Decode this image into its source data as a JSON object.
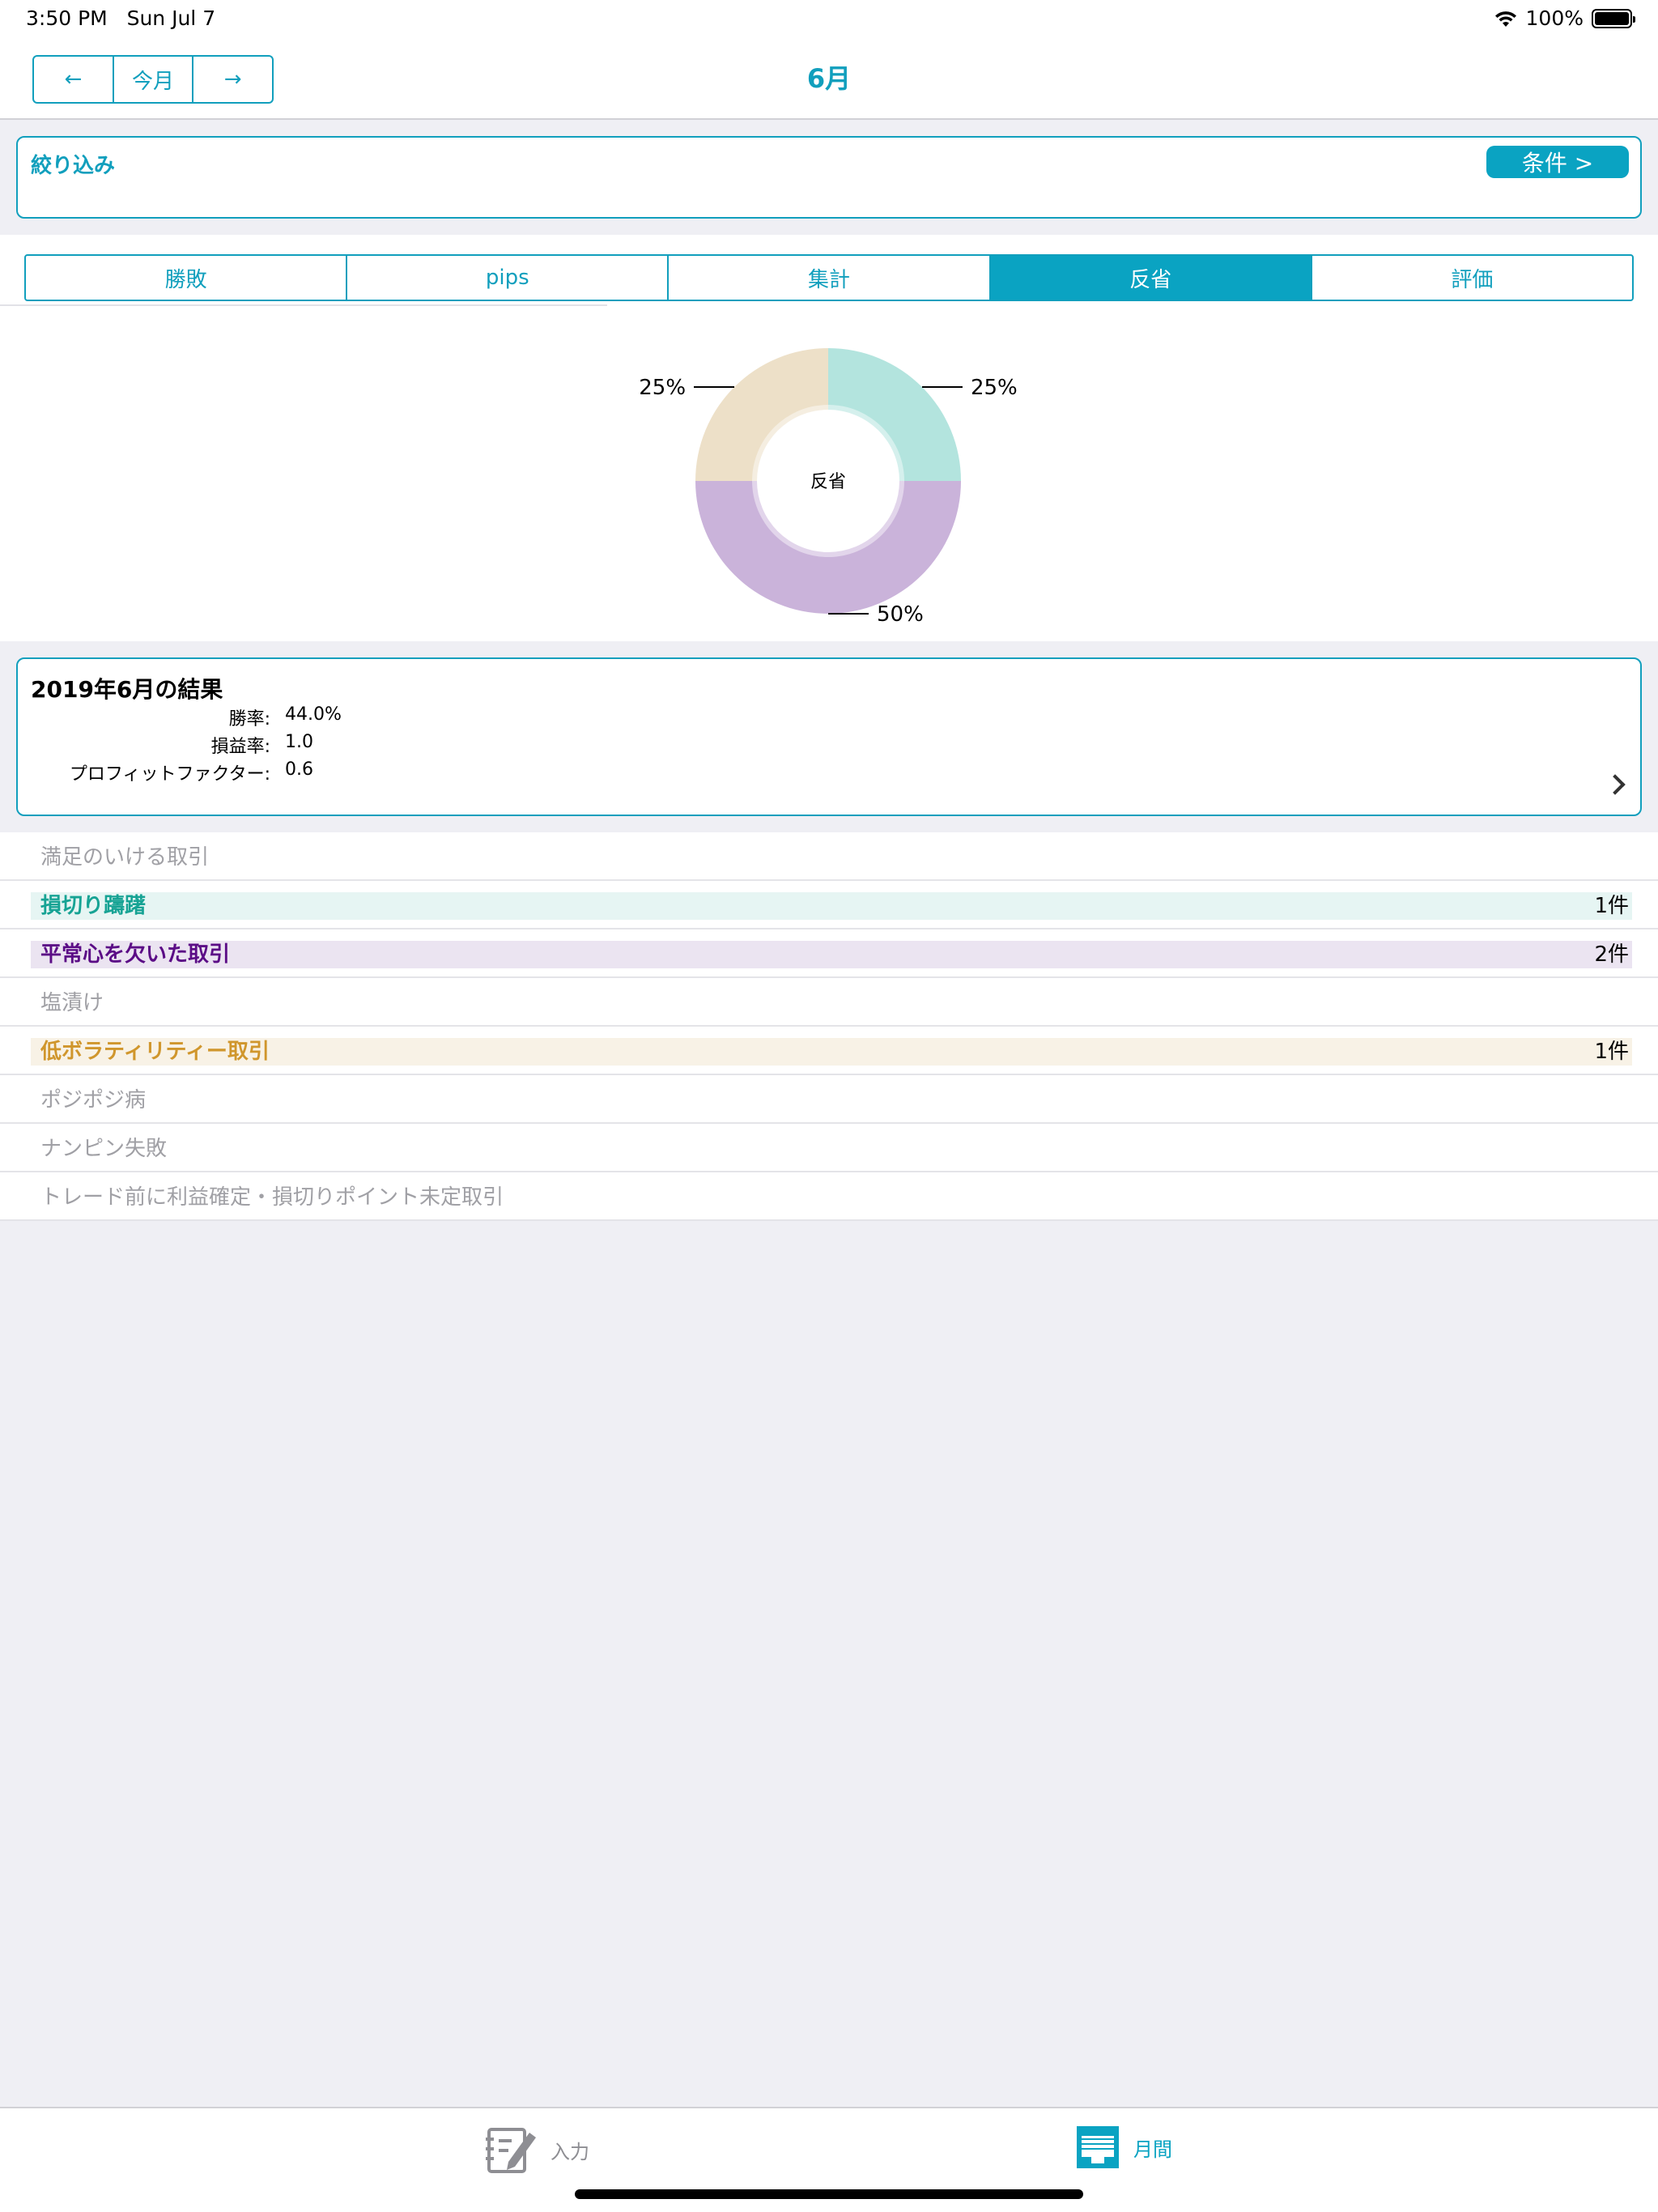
{
  "status_bar": {
    "time": "3:50 PM",
    "date": "Sun Jul 7",
    "battery": "100%"
  },
  "nav": {
    "prev": "←",
    "today": "今月",
    "next": "→",
    "title": "6月"
  },
  "filter": {
    "label": "絞り込み",
    "button": "条件 >"
  },
  "tabs": [
    {
      "label": "勝敗",
      "active": false
    },
    {
      "label": "pips",
      "active": false
    },
    {
      "label": "集計",
      "active": false
    },
    {
      "label": "反省",
      "active": true
    },
    {
      "label": "評価",
      "active": false
    }
  ],
  "chart_data": {
    "type": "pie",
    "center_label": "反省",
    "slices": [
      {
        "label": "損切り躊躇",
        "value": 25,
        "display": "25%",
        "color": "#b3e4de"
      },
      {
        "label": "平常心を欠いた取引",
        "value": 50,
        "display": "50%",
        "color": "#cab3da"
      },
      {
        "label": "低ボラティリティー取引",
        "value": 25,
        "display": "25%",
        "color": "#ede0c8"
      }
    ]
  },
  "summary": {
    "title": "2019年6月の結果",
    "rows": [
      {
        "key": "勝率:",
        "value": "44.0%"
      },
      {
        "key": "損益率:",
        "value": "1.0"
      },
      {
        "key": "プロフィットファクター:",
        "value": "0.6"
      }
    ]
  },
  "reflections": [
    {
      "label": "満足のいける取引",
      "count": "",
      "active": false
    },
    {
      "label": "損切り躊躇",
      "count": "1件",
      "active": true,
      "text_color": "#16a394",
      "bar_color": "#e6f5f3"
    },
    {
      "label": "平常心を欠いた取引",
      "count": "2件",
      "active": true,
      "text_color": "#5b0c86",
      "bar_color": "#ebe4f1"
    },
    {
      "label": "塩漬け",
      "count": "",
      "active": false
    },
    {
      "label": "低ボラティリティー取引",
      "count": "1件",
      "active": true,
      "text_color": "#d0962c",
      "bar_color": "#f8f2e6"
    },
    {
      "label": "ポジポジ病",
      "count": "",
      "active": false
    },
    {
      "label": "ナンピン失敗",
      "count": "",
      "active": false
    },
    {
      "label": "トレード前に利益確定・損切りポイント未定取引",
      "count": "",
      "active": false
    }
  ],
  "tabbar": {
    "input": {
      "label": "入力",
      "icon": "edit-icon",
      "color": "#8e8e93"
    },
    "monthly": {
      "label": "月間",
      "icon": "calendar-icon",
      "color": "#0aa3c2"
    }
  }
}
